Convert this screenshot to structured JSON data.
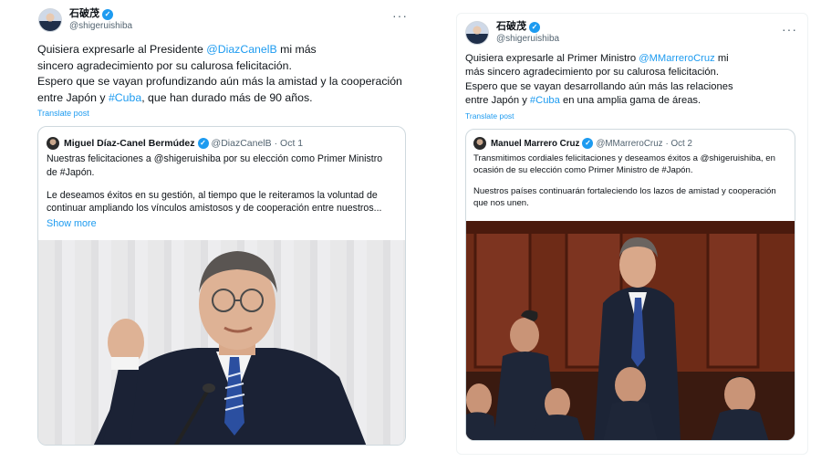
{
  "tweet1": {
    "author_name": "石破茂",
    "handle": "@shigeruishiba",
    "more_label": "···",
    "text_lines": [
      [
        "Quisiera expresarle al Presidente ",
        "@DiazCanelB",
        " mi más"
      ],
      [
        "sincero agradecimiento por su calurosa felicitación."
      ],
      [
        "Espero que se vayan profundizando aún más la amistad y la cooperación"
      ],
      [
        "entre Japón y ",
        "#Cuba",
        ", que han durado más de 90 años."
      ]
    ],
    "translate_label": "Translate post",
    "quote": {
      "author_name": "Miguel Díaz-Canel Bermúdez",
      "handle": "@DiazCanelB",
      "date": "· Oct 1",
      "text_lines": [
        "Nuestras felicitaciones a @shigeruishiba por su elección como Primer Ministro",
        "de #Japón.",
        "",
        "Le deseamos éxitos en su gestión, al tiempo que le reiteramos la voluntad de",
        "continuar ampliando los vínculos amistosos y de cooperación entre nuestros..."
      ],
      "show_more_label": "Show more"
    }
  },
  "tweet2": {
    "author_name": "石破茂",
    "handle": "@shigeruishiba",
    "more_label": "···",
    "text_lines": [
      [
        "Quisiera expresarle al Primer Ministro ",
        "@MMarreroCruz",
        " mi"
      ],
      [
        "más sincero agradecimiento por su calurosa felicitación."
      ],
      [
        "Espero que se vayan desarrollando aún más las relaciones"
      ],
      [
        "entre Japón y ",
        "#Cuba",
        " en una amplia gama de áreas."
      ]
    ],
    "translate_label": "Translate post",
    "quote": {
      "author_name": "Manuel Marrero Cruz",
      "handle": "@MMarreroCruz",
      "date": "· Oct 2",
      "text_lines": [
        "Transmitimos cordiales felicitaciones y deseamos éxitos a @shigeruishiba, en",
        "ocasión de su elección como Primer Ministro de #Japón.",
        "",
        "Nuestros países continuarán fortaleciendo los lazos de amistad y cooperación",
        "que nos unen."
      ]
    }
  },
  "colors": {
    "link": "#1d9bf0",
    "text": "#0f1419",
    "muted": "#536471",
    "border": "#cfd9de"
  }
}
